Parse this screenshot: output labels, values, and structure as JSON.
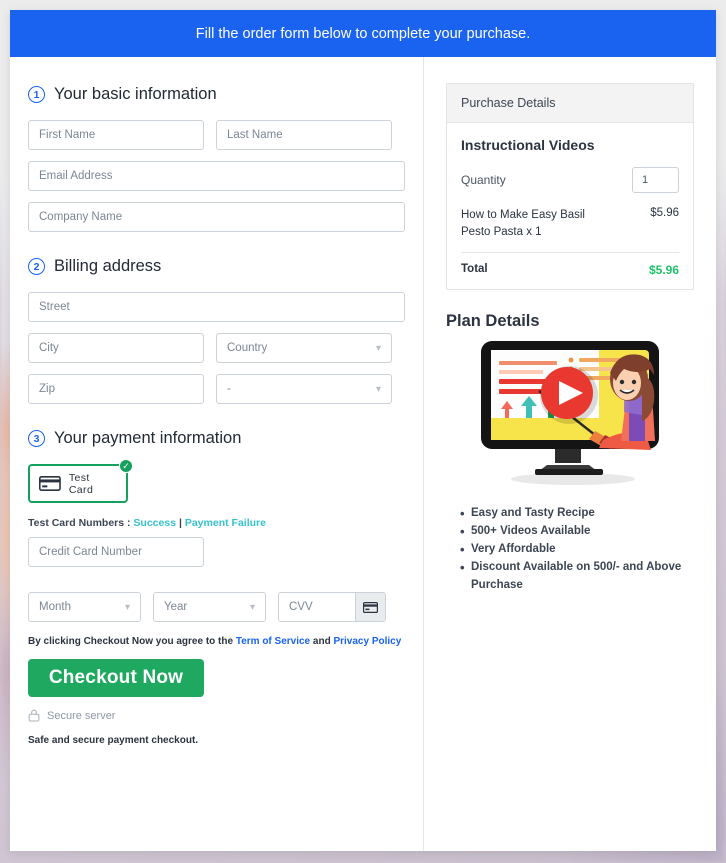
{
  "banner": {
    "text": "Fill the order form below to complete your purchase."
  },
  "sections": {
    "basic": {
      "number": "1",
      "title": "Your basic information",
      "fields": {
        "first_name": "First Name",
        "last_name": "Last Name",
        "email": "Email Address",
        "company": "Company Name"
      }
    },
    "billing": {
      "number": "2",
      "title": "Billing address",
      "fields": {
        "street": "Street",
        "city": "City",
        "country": "Country",
        "zip": "Zip",
        "state": "-"
      }
    },
    "payment": {
      "number": "3",
      "title": "Your payment information",
      "method_label": "Test  Card",
      "method_selected_icon": "check-circle-icon",
      "card_icon": "credit-card-icon",
      "test_numbers_label": "Test Card Numbers :",
      "test_success_link": "Success",
      "test_separator": "|",
      "test_failure_link": "Payment Failure",
      "card_number": "Credit Card Number",
      "month": "Month",
      "year": "Year",
      "cvv": "CVV",
      "cvv_icon": "credit-card-icon"
    }
  },
  "footer": {
    "terms_prefix": "By clicking Checkout Now you agree to the",
    "terms_link": "Term of Service",
    "terms_and": "and",
    "privacy_link": "Privacy Policy",
    "checkout_label": "Checkout Now",
    "secure_icon": "lock-icon",
    "secure_label": "Secure server",
    "safe_note": "Safe and secure payment checkout."
  },
  "purchase_details": {
    "header": "Purchase Details",
    "product_title": "Instructional Videos",
    "quantity_label": "Quantity",
    "quantity_value": "1",
    "item_name": "How to Make Easy Basil Pesto Pasta x 1",
    "item_price": "$5.96",
    "total_label": "Total",
    "total_value": "$5.96"
  },
  "plan_details": {
    "title": "Plan Details",
    "illustration": "video-monitor-illustration",
    "features": [
      "Easy and Tasty Recipe",
      "500+ Videos Available",
      "Very Affordable",
      "Discount Available on 500/- and Above Purchase"
    ]
  },
  "colors": {
    "banner_blue": "#1a62f0",
    "accent_green": "#1fa85f",
    "total_green": "#1fc36a",
    "link_teal": "#35c2cf",
    "link_blue": "#1a62f0"
  }
}
